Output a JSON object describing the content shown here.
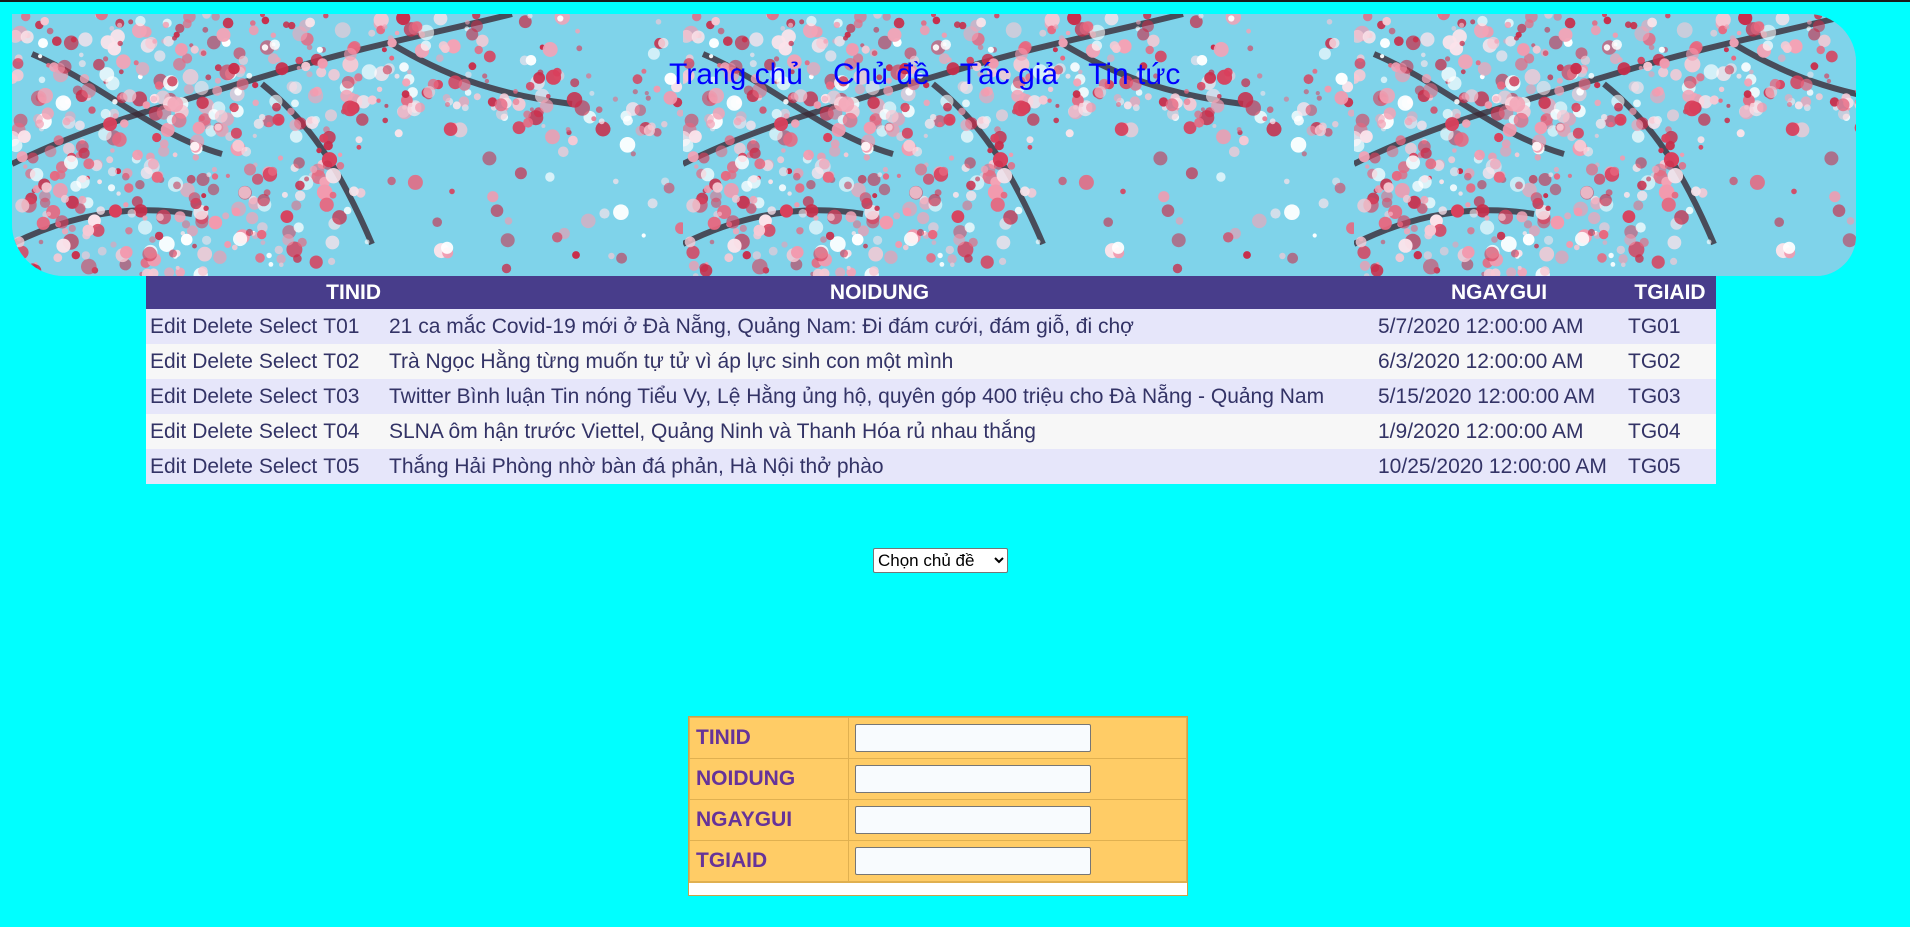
{
  "nav": {
    "items": [
      "Trang chủ",
      "Chủ đề",
      "Tác giả",
      "Tin tức"
    ]
  },
  "grid": {
    "columns": [
      "TINID",
      "NOIDUNG",
      "NGAYGUI",
      "TGIAID"
    ],
    "actions": [
      "Edit",
      "Delete",
      "Select"
    ],
    "rows": [
      {
        "tinid": "T01",
        "noidung": "21 ca mắc Covid-19 mới ở Đà Nẵng, Quảng Nam: Đi đám cưới, đám giỗ, đi chợ",
        "ngaygui": "5/7/2020 12:00:00 AM",
        "tgiaid": "TG01"
      },
      {
        "tinid": "T02",
        "noidung": "Trà Ngọc Hằng từng muốn tự tử vì áp lực sinh con một mình",
        "ngaygui": "6/3/2020 12:00:00 AM",
        "tgiaid": "TG02"
      },
      {
        "tinid": "T03",
        "noidung": "Twitter Bình luận Tin nóng Tiểu Vy, Lệ Hằng ủng hộ, quyên góp 400 triệu cho Đà Nẵng - Quảng Nam",
        "ngaygui": "5/15/2020 12:00:00 AM",
        "tgiaid": "TG03"
      },
      {
        "tinid": "T04",
        "noidung": "SLNA ôm hận trước Viettel, Quảng Ninh và Thanh Hóa rủ nhau thắng",
        "ngaygui": "1/9/2020 12:00:00 AM",
        "tgiaid": "TG04"
      },
      {
        "tinid": "T05",
        "noidung": "Thắng Hải Phòng nhờ bàn đá phản, Hà Nội thở phào",
        "ngaygui": "10/25/2020 12:00:00 AM",
        "tgiaid": "TG05"
      }
    ]
  },
  "topic_select": {
    "selected": "Chọn chủ đề"
  },
  "form": {
    "fields": [
      "TINID",
      "NOIDUNG",
      "NGAYGUI",
      "TGIAID"
    ]
  },
  "colors": {
    "page_bg": "#00ffff",
    "header_bg": "#483d8b",
    "row_odd": "#e6e6fa",
    "row_even": "#f7f7f7",
    "form_bg": "#ffcc66",
    "form_label": "#663399",
    "nav_link": "#0000ff"
  }
}
